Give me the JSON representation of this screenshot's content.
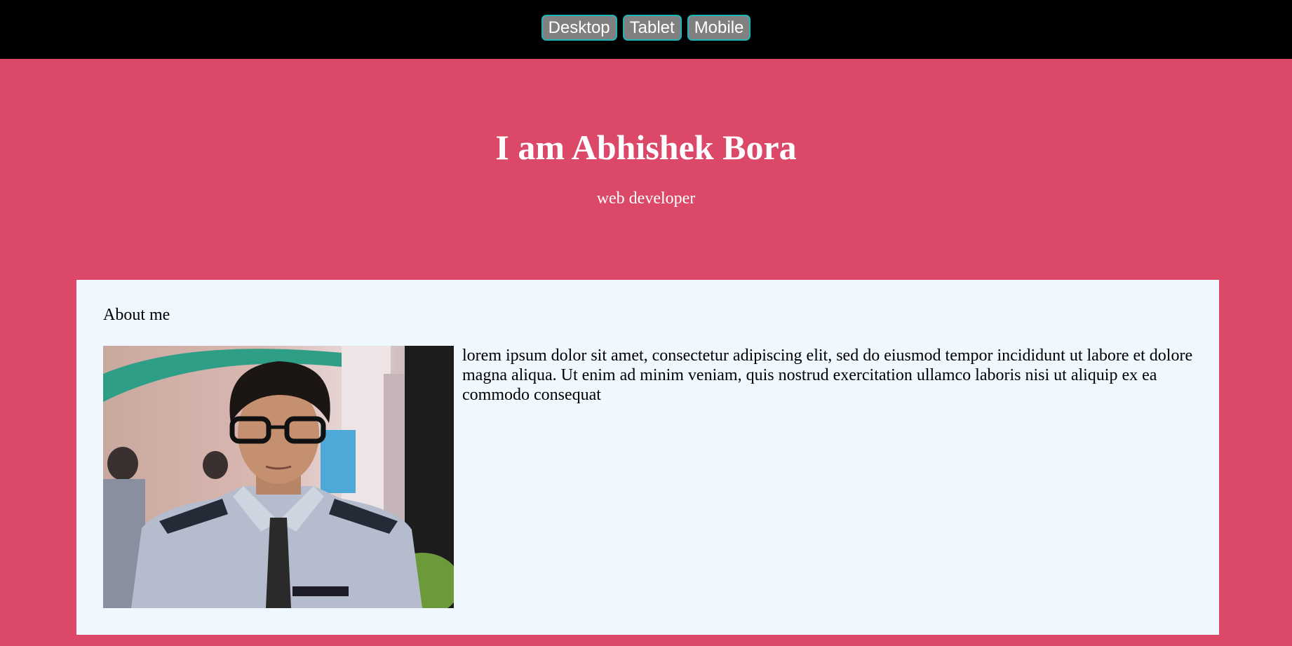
{
  "view_switcher": {
    "buttons": [
      {
        "label": "Desktop"
      },
      {
        "label": "Tablet"
      },
      {
        "label": "Mobile"
      }
    ]
  },
  "hero": {
    "title": "I am Abhishek Bora",
    "subtitle": "web developer"
  },
  "about": {
    "heading": "About me",
    "text": "lorem ipsum dolor sit amet, consectetur adipiscing elit, sed do eiusmod tempor incididunt ut labore et dolore magna aliqua. Ut enim ad minim veniam, quis nostrud exercitation ullamco laboris nisi ut aliquip ex ea commodo consequat",
    "photo_icon": "profile-photo"
  },
  "colors": {
    "topbar": "#000000",
    "hero_bg": "#dc4868",
    "card_bg": "#f0f8ff",
    "button_bg": "#808080",
    "button_border": "#1fb5b5"
  }
}
